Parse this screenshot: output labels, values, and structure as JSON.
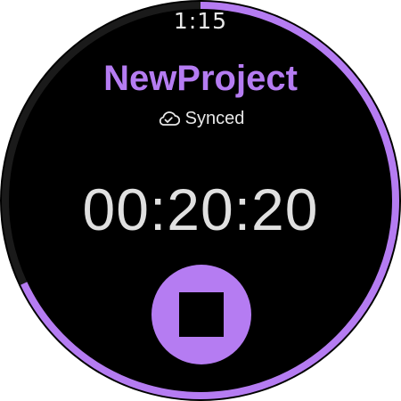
{
  "status_bar": {
    "time": "1:15"
  },
  "project": {
    "title": "NewProject",
    "sync_status": "Synced",
    "sync_icon": "cloud-check-icon"
  },
  "timer": {
    "elapsed": "00:20:20",
    "progress_fraction": 0.68
  },
  "controls": {
    "stop_icon": "stop-icon"
  },
  "colors": {
    "accent": "#b57cf2",
    "background": "#000000",
    "text": "#e8e8e8",
    "ring_track": "#1a1a1a"
  }
}
